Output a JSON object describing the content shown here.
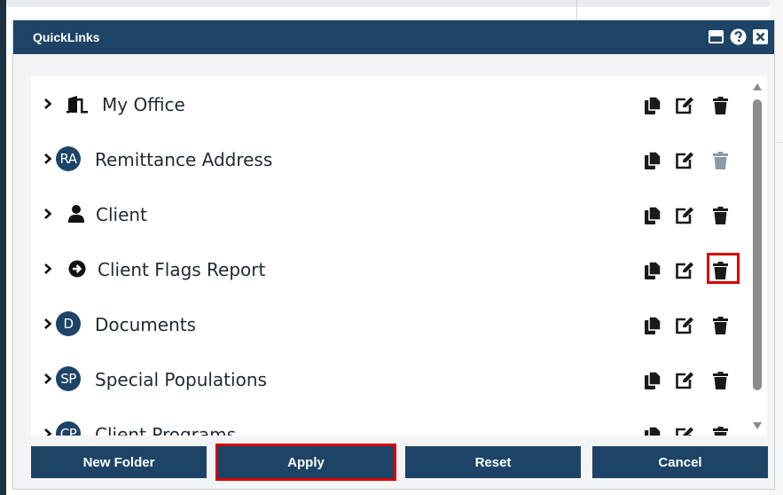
{
  "dialog": {
    "title": "QuickLinks"
  },
  "items": [
    {
      "label": "My Office",
      "icon": "office-door-icon"
    },
    {
      "label": "Remittance Address",
      "icon": "circle-badge-icon",
      "badge": "RA"
    },
    {
      "label": "Client",
      "icon": "user-icon"
    },
    {
      "label": "Client Flags Report",
      "icon": "arrow-circle-right-icon"
    },
    {
      "label": "Documents",
      "icon": "circle-badge-icon",
      "badge": "D"
    },
    {
      "label": "Special Populations",
      "icon": "circle-badge-icon",
      "badge": "SP"
    },
    {
      "label": "Client Programs",
      "icon": "circle-badge-icon",
      "badge": "CP"
    }
  ],
  "buttons": {
    "new_folder": "New Folder",
    "apply": "Apply",
    "reset": "Reset",
    "cancel": "Cancel"
  },
  "colors": {
    "primary": "#1d4466",
    "highlight": "#d90000",
    "disabled_icon": "#8a9aa8"
  }
}
